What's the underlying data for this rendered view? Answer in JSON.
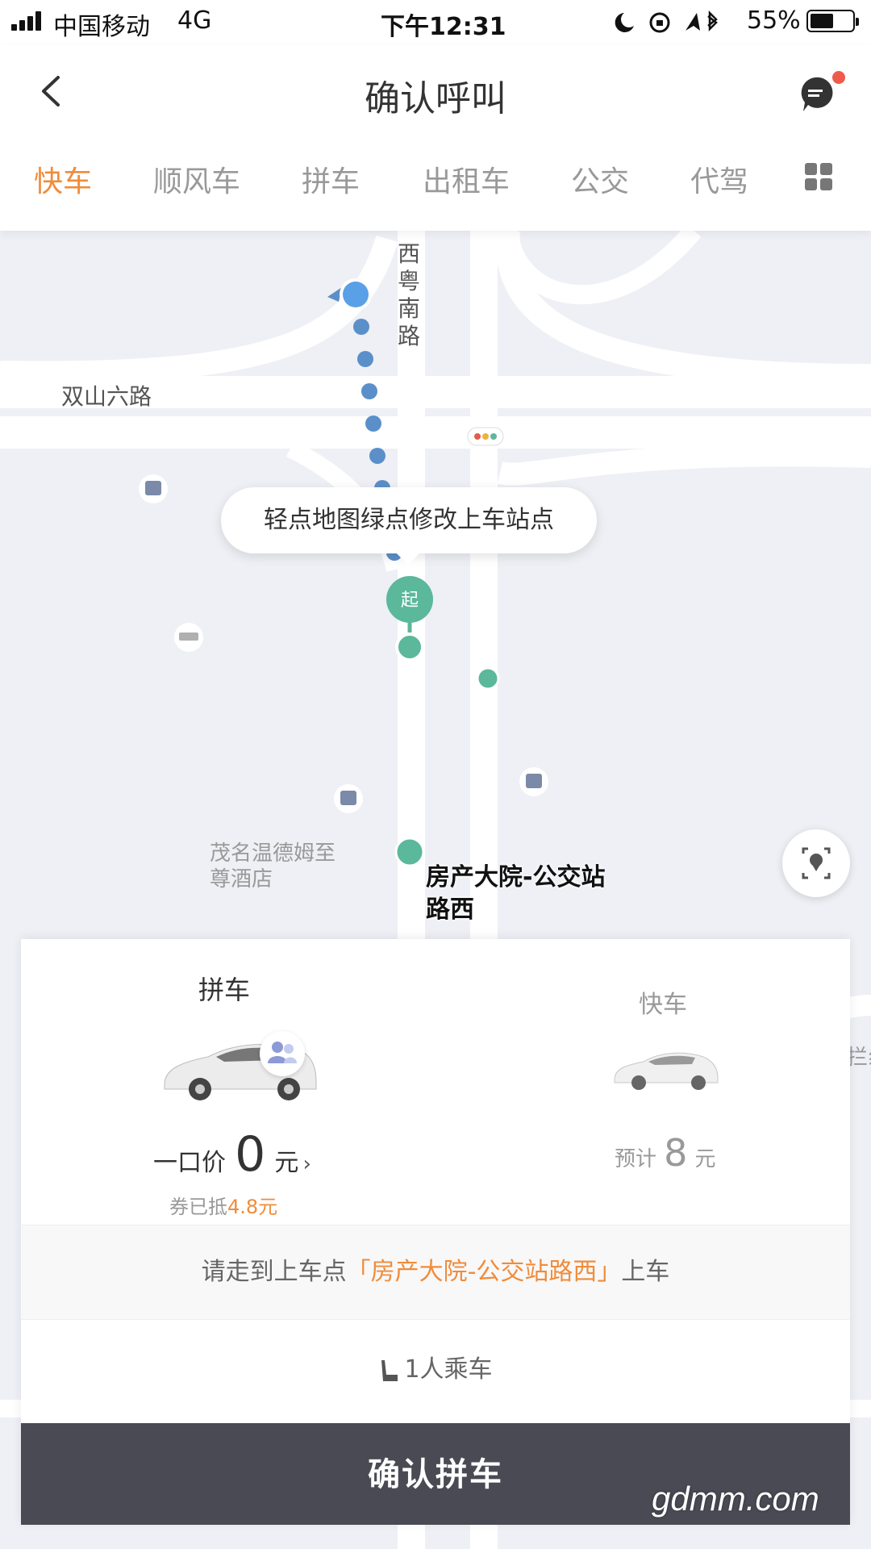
{
  "status_bar": {
    "carrier": "中国移动",
    "network": "4G",
    "time": "下午12:31",
    "battery_pct": "55%"
  },
  "header": {
    "title": "确认呼叫",
    "tabs": [
      {
        "label": "快车",
        "active": true
      },
      {
        "label": "顺风车",
        "active": false
      },
      {
        "label": "拼车",
        "active": false
      },
      {
        "label": "出租车",
        "active": false
      },
      {
        "label": "公交",
        "active": false
      },
      {
        "label": "代驾",
        "active": false
      }
    ]
  },
  "map": {
    "roads": {
      "vertical": "西粤南路",
      "horizontal": "双山六路"
    },
    "tooltip": "轻点地图绿点修改上车站点",
    "start_marker": "起",
    "pickup_name": "房产大院-公交站路西",
    "poi_hotel": "茂名温德姆至尊酒店",
    "partial_right_label": "拦纟"
  },
  "card": {
    "pool": {
      "title": "拼车",
      "price_prefix": "一口价",
      "price": "0",
      "unit": "元",
      "coupon_prefix": "券已抵",
      "coupon_amount": "4.8元"
    },
    "express": {
      "title": "快车",
      "price_prefix": "预计",
      "price": "8",
      "unit": "元"
    },
    "walk_hint": {
      "prefix": "请走到上车点",
      "place": "「房产大院-公交站路西」",
      "suffix": "上车"
    },
    "passengers": "1人乘车",
    "confirm_button": "确认拼车"
  },
  "watermark": "gdmm.com",
  "colors": {
    "accent": "#f08c3a",
    "route_blue": "#5b8fc9",
    "pickup_green": "#5bb89a",
    "button_dark": "#4a4a55"
  }
}
